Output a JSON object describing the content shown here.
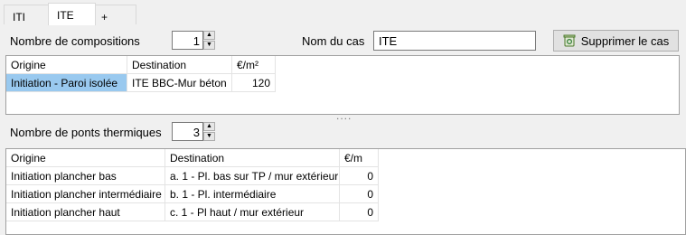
{
  "tabs": [
    {
      "label": "ITI"
    },
    {
      "label": "ITE"
    },
    {
      "label": "+"
    }
  ],
  "compositions": {
    "count_label": "Nombre de compositions",
    "count_value": "1",
    "case_name_label": "Nom du cas",
    "case_name_value": "ITE",
    "delete_label": "Supprimer le cas",
    "headers": [
      "Origine",
      "Destination",
      "€/m²"
    ],
    "rows": [
      {
        "origine": "Initiation - Paroi isolée",
        "destination": "ITE BBC-Mur béton",
        "value": "120"
      }
    ]
  },
  "splitter": "....",
  "bridges": {
    "count_label": "Nombre de ponts thermiques",
    "count_value": "3",
    "headers": [
      "Origine",
      "Destination",
      "€/m"
    ],
    "rows": [
      {
        "origine": "Initiation plancher bas",
        "destination": "a. 1 - Pl. bas sur TP / mur extérieur",
        "value": "0"
      },
      {
        "origine": "Initiation plancher intermédiaire",
        "destination": "b. 1 - Pl. intermédiaire",
        "value": "0"
      },
      {
        "origine": "Initiation plancher haut",
        "destination": "c. 1 - Pl haut / mur extérieur",
        "value": "0"
      }
    ]
  }
}
